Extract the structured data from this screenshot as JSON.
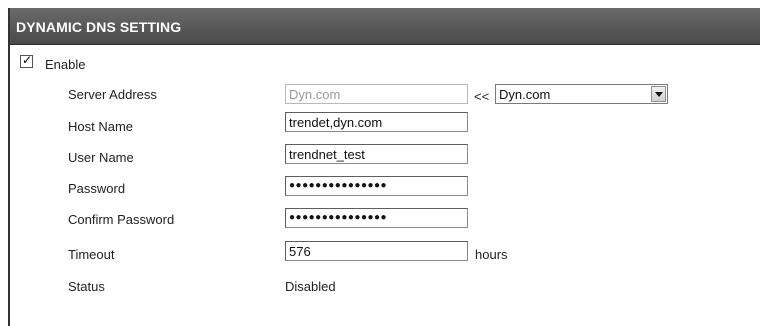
{
  "header": {
    "title": "DYNAMIC DNS SETTING"
  },
  "enable": {
    "label": "Enable",
    "checked": true,
    "check_glyph": "✓"
  },
  "fields": {
    "server_address": {
      "label": "Server Address",
      "value": "Dyn.com",
      "arrows": "<<",
      "select_value": "Dyn.com"
    },
    "host_name": {
      "label": "Host Name",
      "value": "trendet,dyn.com"
    },
    "user_name": {
      "label": "User Name",
      "value": "trendnet_test"
    },
    "password": {
      "label": "Password",
      "value": "●●●●●●●●●●●●●●●"
    },
    "confirm_password": {
      "label": "Confirm Password",
      "value": "●●●●●●●●●●●●●●●"
    },
    "timeout": {
      "label": "Timeout",
      "value": "576",
      "unit": "hours"
    },
    "status": {
      "label": "Status",
      "value": "Disabled"
    }
  },
  "colors": {
    "header_bg": "#555555",
    "header_text": "#ffffff",
    "disabled_text": "#9a9a9a"
  }
}
